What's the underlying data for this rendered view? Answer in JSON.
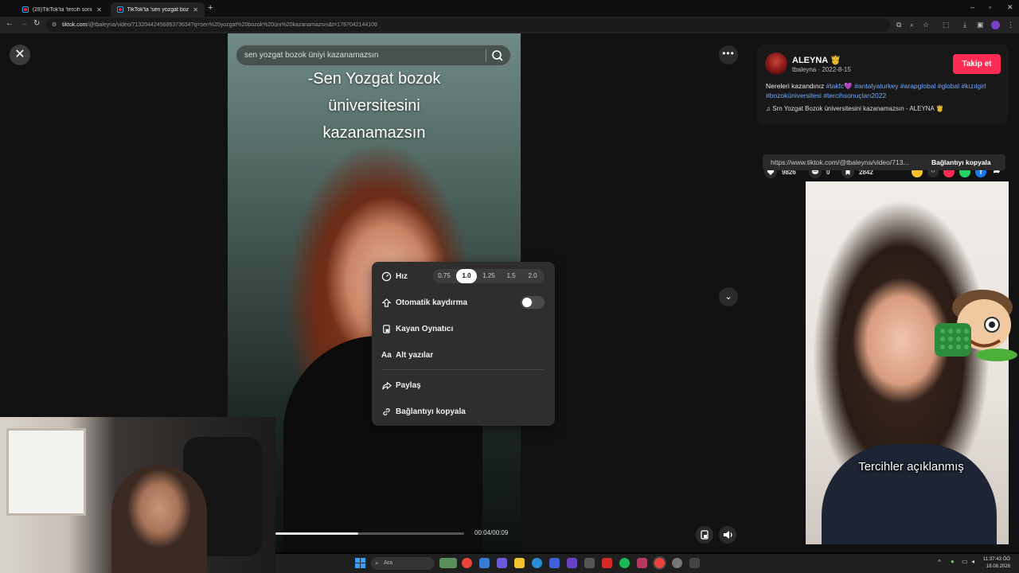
{
  "browser": {
    "tabs": [
      {
        "title": "(28)TikTok'ta 'tercih sonuç...",
        "active": false
      },
      {
        "title": "TikTok'ta 'sen yozgat bozok ün...",
        "active": true
      }
    ],
    "url_domain": "tiktok.com",
    "url_rest": "/@tbaleyna/video/7132044245686373634?q=sen%20yozgat%20bozok%20üni%20kazanamazsın&t=1787042144109"
  },
  "search": {
    "value": "sen yozgat bozok üniyi kazanamazsın"
  },
  "video": {
    "caption_lines": [
      "-Sen Yozgat bozok",
      "üniversitesini",
      "kazanamazsın"
    ],
    "time": "00:04/00:09",
    "progress_fraction": 0.44
  },
  "menu": {
    "speed_label": "Hız",
    "speeds": [
      "0.75",
      "1.0",
      "1.25",
      "1.5",
      "2.0"
    ],
    "selected_speed": "1.0",
    "autoscroll_label": "Otomatik kaydırma",
    "autoscroll_on": false,
    "floating_player_label": "Kayan Oynatıcı",
    "subtitles_label": "Alt yazılar",
    "share_label": "Paylaş",
    "copy_link_label": "Bağlantıyı kopyala"
  },
  "post": {
    "author": "ALEYNA 🤴",
    "handle_date": "tbaleyna · 2022-8-15",
    "follow_label": "Takip et",
    "description_prefix": "Nereleri kazandınız ",
    "hashtags": [
      "#takfc💜",
      "#antalyaturkey",
      "#arapglobal",
      "#global",
      "#kızılgirl",
      "#bozoküniversitesi",
      "#tercihsonuçları2022"
    ],
    "music": "♫  Srn Yozgat Bozok üniversitesini kazanamazsın - ALEYNA 🤴",
    "likes": "9826",
    "comments": "0",
    "saves": "2842",
    "link": "https://www.tiktok.com/@tbaleyna/video/713...",
    "copy_link_label": "Bağlantıyı kopyala"
  },
  "next_video": {
    "caption": "Tercihler açıklanmış"
  },
  "taskbar": {
    "search_label": "Ara",
    "time": "11:37:43 ÖÖ",
    "date": "18.08.2026"
  },
  "colors": {
    "accent": "#fe2c55",
    "hashtag": "#6fa8ff"
  }
}
